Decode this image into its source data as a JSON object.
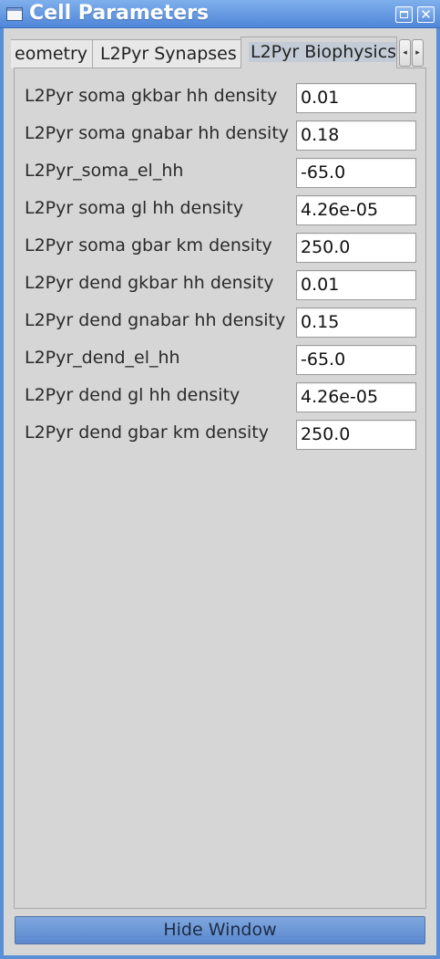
{
  "window": {
    "title": "Cell Parameters",
    "restore_icon": "restore-icon",
    "close_icon": "close-icon",
    "close_glyph": "✕"
  },
  "tabs": [
    {
      "label": "eometry",
      "active": false
    },
    {
      "label": "L2Pyr Synapses",
      "active": false
    },
    {
      "label": "L2Pyr Biophysics",
      "active": true
    }
  ],
  "tab_scroll": {
    "left_glyph": "◂",
    "right_glyph": "▸"
  },
  "params": [
    {
      "label": "L2Pyr soma gkbar hh density",
      "value": "0.01"
    },
    {
      "label": "L2Pyr soma gnabar hh density",
      "value": "0.18"
    },
    {
      "label": "L2Pyr_soma_el_hh",
      "value": "-65.0"
    },
    {
      "label": "L2Pyr soma gl hh density",
      "value": "4.26e-05"
    },
    {
      "label": "L2Pyr soma gbar km density",
      "value": "250.0"
    },
    {
      "label": "L2Pyr dend gkbar hh density",
      "value": "0.01"
    },
    {
      "label": "L2Pyr dend gnabar hh density",
      "value": "0.15"
    },
    {
      "label": "L2Pyr_dend_el_hh",
      "value": "-65.0"
    },
    {
      "label": "L2Pyr dend gl hh density",
      "value": "4.26e-05"
    },
    {
      "label": "L2Pyr dend gbar km density",
      "value": "250.0"
    }
  ],
  "footer": {
    "hide_button_label": "Hide Window"
  },
  "colors": {
    "titlebar": "#4f86d8",
    "background": "#d6d6d6",
    "accent": "#5b88cf"
  }
}
